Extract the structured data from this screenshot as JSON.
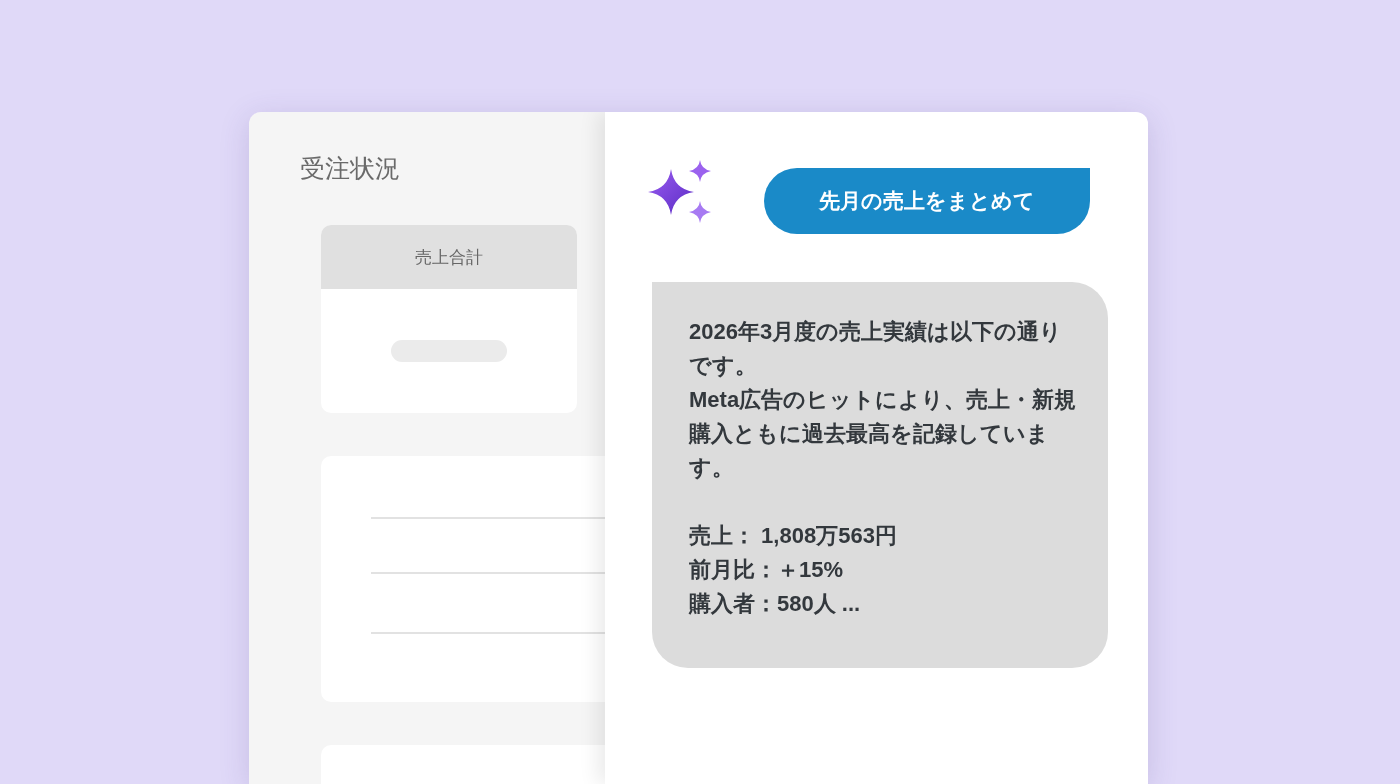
{
  "dashboard": {
    "title": "受注状況",
    "summary_card": {
      "header": "売上合計"
    }
  },
  "chat": {
    "user_message": "先月の売上をまとめて",
    "reply": {
      "paragraphs": [
        "2026年3月度の売上実績は以下の通りです。",
        "Meta広告のヒットにより、売上・新規購入ともに過去最高を記録しています。"
      ],
      "stats": [
        "売上： 1,808万563円",
        "前月比：＋15%",
        "購入者：580人 ..."
      ]
    }
  }
}
